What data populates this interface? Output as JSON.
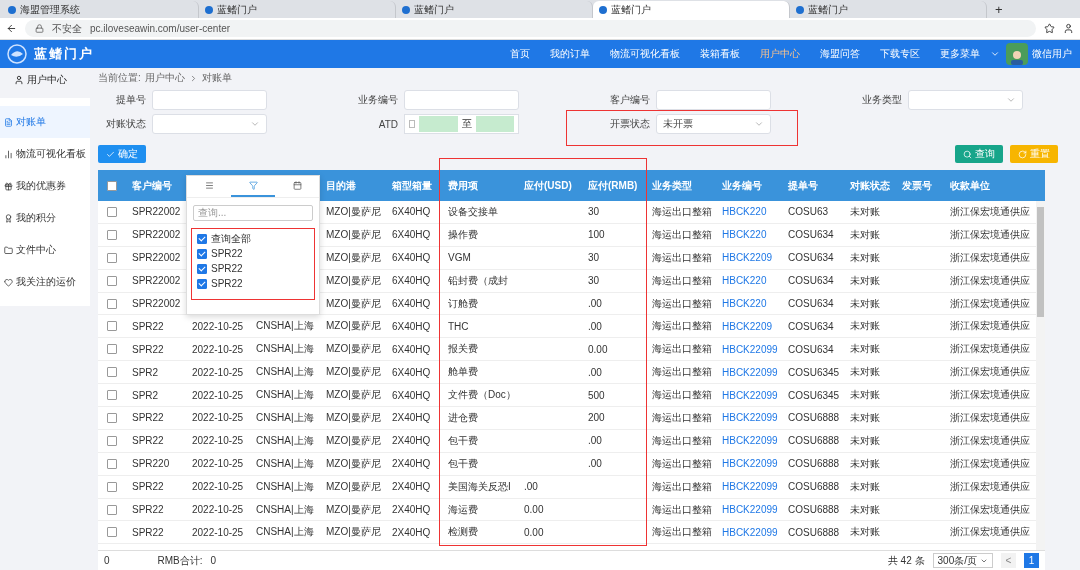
{
  "browser": {
    "tabs": [
      {
        "label": "海盟管理系统",
        "selected": false
      },
      {
        "label": "蓝鳍门户",
        "selected": false
      },
      {
        "label": "蓝鳍门户",
        "selected": false
      },
      {
        "label": "蓝鳍门户",
        "selected": true
      },
      {
        "label": "蓝鳍门户",
        "selected": false
      }
    ],
    "new_tab": "+",
    "security": "不安全",
    "url": "pc.iloveseawin.com/user-center"
  },
  "header": {
    "logo": "蓝鳍门户",
    "nav": [
      {
        "label": "首页",
        "selected": false
      },
      {
        "label": "我的订单",
        "selected": false
      },
      {
        "label": "物流可视化看板",
        "selected": false
      },
      {
        "label": "装箱看板",
        "selected": false
      },
      {
        "label": "用户中心",
        "selected": true
      },
      {
        "label": "海盟问答",
        "selected": false
      },
      {
        "label": "下载专区",
        "selected": false
      },
      {
        "label": "更多菜单",
        "selected": false
      }
    ],
    "user": "微信用户"
  },
  "sidebar": {
    "title": "用户中心",
    "items": [
      {
        "label": "对账单",
        "selected": true
      },
      {
        "label": "物流可视化看板",
        "selected": false
      },
      {
        "label": "我的优惠券",
        "selected": false
      },
      {
        "label": "我的积分",
        "selected": false
      },
      {
        "label": "文件中心",
        "selected": false
      },
      {
        "label": "我关注的运价",
        "selected": false
      }
    ]
  },
  "breadcrumb": [
    "当前位置:",
    "用户中心",
    "对账单"
  ],
  "filters": [
    {
      "label": "提单号",
      "kind": "text"
    },
    {
      "label": "业务编号",
      "kind": "text"
    },
    {
      "label": "客户编号",
      "kind": "text"
    },
    {
      "label": "业务类型",
      "kind": "select"
    },
    {
      "label": "对账状态",
      "kind": "select"
    },
    {
      "label": "ATD",
      "kind": "range",
      "separator": "至"
    },
    {
      "label": "开票状态",
      "kind": "select",
      "value": "未开票"
    }
  ],
  "buttons": {
    "confirm": "确定",
    "search": "查询",
    "reset": "重置"
  },
  "table": {
    "all_checked": false,
    "columns": [
      "客户编号",
      "",
      "",
      "目的港",
      "箱型箱量",
      "费用项",
      "应付(USD)",
      "应付(RMB)",
      "业务类型",
      "业务编号",
      "提单号",
      "对账状态",
      "发票号",
      "收款单位"
    ],
    "rows": [
      {
        "checked": false,
        "cells": [
          "SPR22002",
          null,
          null,
          "MZO|曼萨尼",
          "6X40HQ",
          "设备交接单",
          null,
          "30",
          "海运出口整箱",
          "HBCK220",
          "COSU63",
          "未对账",
          null,
          "浙江保宏境通供应"
        ]
      },
      {
        "checked": false,
        "cells": [
          "SPR22002",
          null,
          null,
          "MZO|曼萨尼",
          "6X40HQ",
          "操作费",
          null,
          "100",
          "海运出口整箱",
          "HBCK220",
          "COSU634",
          "未对账",
          null,
          "浙江保宏境通供应"
        ]
      },
      {
        "checked": false,
        "cells": [
          "SPR22002",
          null,
          null,
          "MZO|曼萨尼",
          "6X40HQ",
          "VGM",
          null,
          "30",
          "海运出口整箱",
          "HBCK2209",
          "COSU634",
          "未对账",
          null,
          "浙江保宏境通供应"
        ]
      },
      {
        "checked": false,
        "cells": [
          "SPR22002",
          null,
          null,
          "MZO|曼萨尼",
          "6X40HQ",
          "铅封费（成封",
          null,
          "30",
          "海运出口整箱",
          "HBCK220",
          "COSU634",
          "未对账",
          null,
          "浙江保宏境通供应"
        ]
      },
      {
        "checked": false,
        "cells": [
          "SPR22002",
          null,
          null,
          "MZO|曼萨尼",
          "6X40HQ",
          "订舱费",
          null,
          ".00",
          "海运出口整箱",
          "HBCK220",
          "COSU634",
          "未对账",
          null,
          "浙江保宏境通供应"
        ]
      },
      {
        "checked": false,
        "cells": [
          "SPR22",
          "2022-10-25",
          "CNSHA|上海",
          "MZO|曼萨尼",
          "6X40HQ",
          "THC",
          null,
          ".00",
          "海运出口整箱",
          "HBCK2209",
          "COSU634",
          "未对账",
          null,
          "浙江保宏境通供应"
        ]
      },
      {
        "checked": false,
        "cells": [
          "SPR22",
          "2022-10-25",
          "CNSHA|上海",
          "MZO|曼萨尼",
          "6X40HQ",
          "报关费",
          null,
          "0.00",
          "海运出口整箱",
          "HBCK22099",
          "COSU634",
          "未对账",
          null,
          "浙江保宏境通供应"
        ]
      },
      {
        "checked": false,
        "cells": [
          "SPR2",
          "2022-10-25",
          "CNSHA|上海",
          "MZO|曼萨尼",
          "6X40HQ",
          "舱单费",
          null,
          ".00",
          "海运出口整箱",
          "HBCK22099",
          "COSU6345",
          "未对账",
          null,
          "浙江保宏境通供应"
        ]
      },
      {
        "checked": false,
        "cells": [
          "SPR2",
          "2022-10-25",
          "CNSHA|上海",
          "MZO|曼萨尼",
          "6X40HQ",
          "文件费（Doc）",
          null,
          "500",
          "海运出口整箱",
          "HBCK22099",
          "COSU6345",
          "未对账",
          null,
          "浙江保宏境通供应"
        ]
      },
      {
        "checked": false,
        "cells": [
          "SPR22",
          "2022-10-25",
          "CNSHA|上海",
          "MZO|曼萨尼",
          "2X40HQ",
          "进仓费",
          null,
          "200",
          "海运出口整箱",
          "HBCK22099",
          "COSU6888",
          "未对账",
          null,
          "浙江保宏境通供应"
        ]
      },
      {
        "checked": false,
        "cells": [
          "SPR22",
          "2022-10-25",
          "CNSHA|上海",
          "MZO|曼萨尼",
          "2X40HQ",
          "包干费",
          null,
          ".00",
          "海运出口整箱",
          "HBCK22099",
          "COSU6888",
          "未对账",
          null,
          "浙江保宏境通供应"
        ]
      },
      {
        "checked": false,
        "cells": [
          "SPR220",
          "2022-10-25",
          "CNSHA|上海",
          "MZO|曼萨尼",
          "2X40HQ",
          "包干费",
          null,
          ".00",
          "海运出口整箱",
          "HBCK22099",
          "COSU6888",
          "未对账",
          null,
          "浙江保宏境通供应"
        ]
      },
      {
        "checked": false,
        "cells": [
          "SPR22",
          "2022-10-25",
          "CNSHA|上海",
          "MZO|曼萨尼",
          "2X40HQ",
          "美国海关反恐I",
          ".00",
          null,
          "海运出口整箱",
          "HBCK22099",
          "COSU6888",
          "未对账",
          null,
          "浙江保宏境通供应"
        ]
      },
      {
        "checked": false,
        "cells": [
          "SPR22",
          "2022-10-25",
          "CNSHA|上海",
          "MZO|曼萨尼",
          "2X40HQ",
          "海运费",
          "0.00",
          null,
          "海运出口整箱",
          "HBCK22099",
          "COSU6888",
          "未对账",
          null,
          "浙江保宏境通供应"
        ]
      },
      {
        "checked": false,
        "cells": [
          "SPR22",
          "2022-10-25",
          "CNSHA|上海",
          "MZO|曼萨尼",
          "2X40HQ",
          "检测费",
          "0.00",
          null,
          "海运出口整箱",
          "HBCK22099",
          "COSU6888",
          "未对账",
          null,
          "浙江保宏境通供应"
        ]
      }
    ]
  },
  "column_menu": {
    "tabs": [
      {
        "kind": "menu",
        "selected": false
      },
      {
        "kind": "filter",
        "selected": true
      },
      {
        "kind": "columns",
        "selected": false
      }
    ],
    "placeholder": "查询...",
    "options": [
      {
        "label": "查询全部",
        "checked": true
      },
      {
        "label": "SPR22",
        "checked": true
      },
      {
        "label": "SPR22",
        "checked": true
      },
      {
        "label": "SPR22",
        "checked": true
      }
    ]
  },
  "footer": {
    "usd_total": "0",
    "rmb_label": "RMB合计:",
    "rmb_total": "0",
    "count": "共 42 条",
    "page_size": "300条/页",
    "prev": "<",
    "pages": [
      {
        "label": "1",
        "selected": true
      }
    ]
  }
}
